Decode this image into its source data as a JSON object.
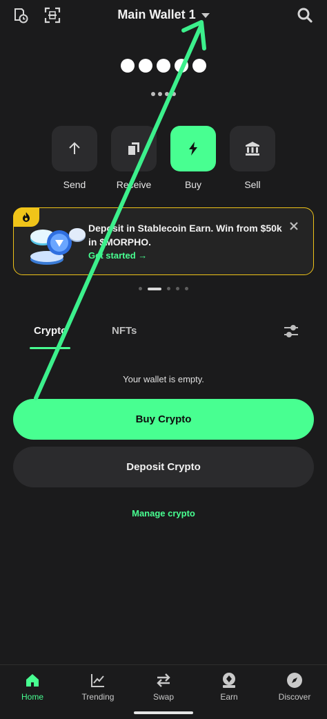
{
  "header": {
    "wallet_name": "Main Wallet 1",
    "icons": [
      "history-icon",
      "scan-icon",
      "search-icon"
    ]
  },
  "balance": {
    "hidden_value": "●●●●●",
    "hidden_sub": "••••"
  },
  "actions": [
    {
      "label": "Send",
      "icon": "arrow-up-icon"
    },
    {
      "label": "Receive",
      "icon": "copy-icon"
    },
    {
      "label": "Buy",
      "icon": "lightning-icon"
    },
    {
      "label": "Sell",
      "icon": "bank-icon"
    }
  ],
  "promo": {
    "text": "Deposit in Stablecoin Earn. Win from $50k in $MORPHO.",
    "cta": "Get started →"
  },
  "tabs": [
    {
      "label": "Crypto",
      "active": true
    },
    {
      "label": "NFTs",
      "active": false
    }
  ],
  "empty_message": "Your wallet is empty.",
  "buttons": {
    "buy_crypto": "Buy Crypto",
    "deposit_crypto": "Deposit Crypto",
    "manage_crypto": "Manage crypto"
  },
  "bottom_nav": [
    {
      "label": "Home",
      "icon": "home-icon",
      "active": true
    },
    {
      "label": "Trending",
      "icon": "chart-icon",
      "active": false
    },
    {
      "label": "Swap",
      "icon": "swap-icon",
      "active": false
    },
    {
      "label": "Earn",
      "icon": "earn-icon",
      "active": false
    },
    {
      "label": "Discover",
      "icon": "compass-icon",
      "active": false
    }
  ],
  "colors": {
    "accent": "#48ff91",
    "background": "#1b1b1c",
    "surface": "#2b2b2d",
    "promo_border": "#f0c419"
  }
}
